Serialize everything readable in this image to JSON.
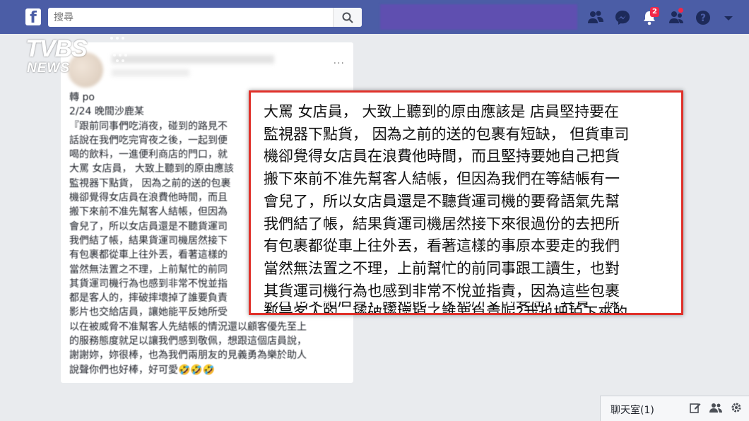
{
  "header": {
    "logo_letter": "f",
    "search_placeholder": "搜尋",
    "notifications_count": "2"
  },
  "watermark": {
    "brand": "TVBS",
    "sub": "NEWS"
  },
  "post": {
    "more": "...",
    "lines": "轉 po\n2/24 晚間沙鹿某\n『跟前同事們吃消夜，碰到的路見不\n話說在我們吃完宵夜之後，一起到便\n喝的飲料，一進便利商店的門口，就\n大罵 女店員， 大致上聽到的原由應該\n監視器下點貨， 因為之前的送的包裹\n機卻覺得女店員在浪費他時間，而且\n搬下來前不准先幫客人結帳，但因為\n會兒了，所以女店員還是不聽貨運司\n我們結了帳，結果貨運司機居然接下\n有包裹都從車上往外丟，看著這樣的\n當然無法置之不理，上前幫忙的前同\n其貨運司機行為也感到非常不悅並指\n都是客人的，摔破摔壞掉了誰要負責\n影片也交給店員，讓她能平反她所受\n以在被威脅不准幫客人先結帳的情況還以顧客優先至上\n的服務態度就足以讓我們感到敬佩，想跟這個店員說，\n謝謝妳，妳很棒，也為我們兩朋友的見義勇為樂於助人\n說聲你們也好棒，好可愛🤣🤣🤣"
  },
  "zoom": {
    "lines": "大罵 女店員， 大致上聽到的原由應該是 店員堅持要在\n監視器下點貨， 因為之前的送的包裹有短缺， 但貨車司\n機卻覺得女店員在浪費他時間，而且堅持要她自己把貨\n搬下來前不准先幫客人結帳，但因為我們在等結帳有一\n會兒了，所以女店員還是不聽貨運司機的要脅語氣先幫\n我們結了帳，結果貨運司機居然接下來很過份的去把所\n有包裹都從車上往外丟，看著這樣的事原本要走的我們\n當然無法置之不理，上前幫忙的前同事跟工讀生，也對\n其貨運司機行為也感到非常不悅並指責，因為這些包裹\n都是客人的，摔破摔壞掉了誰要負責呢?我也把拍下來的",
    "cut_line": "影片也交給店員，讓她能平反她所受的委屈，其實一樣"
  },
  "chat": {
    "label": "聊天室(1)"
  },
  "colors": {
    "topbar": "#4b5da6",
    "accent_border": "#e0312a"
  }
}
